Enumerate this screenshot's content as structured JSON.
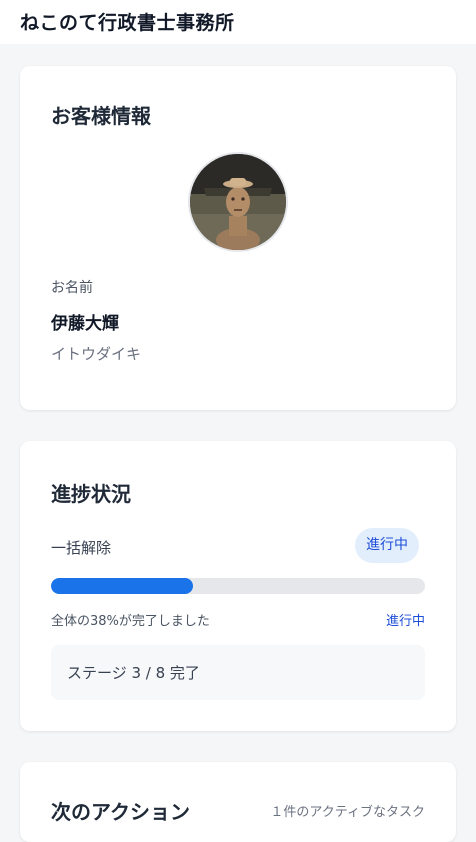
{
  "header": {
    "title": "ねこのて行政書士事務所"
  },
  "customer": {
    "title": "お客様情報",
    "avatar_icon": "person-photo",
    "name_label": "お名前",
    "name": "伊藤大輝",
    "name_kana": "イトウダイキ"
  },
  "progress": {
    "title": "進捗状況",
    "procedure": "一括解除",
    "status_pill": "進行中",
    "percent": 38,
    "completion_text": "全体の38%が完了しました",
    "status_text": "進行中",
    "stage_text": "ステージ 3 / 8 完了",
    "accent_color": "#1a73e8"
  },
  "next_actions": {
    "title": "次のアクション",
    "count_text": "１件のアクティブなタスク"
  }
}
